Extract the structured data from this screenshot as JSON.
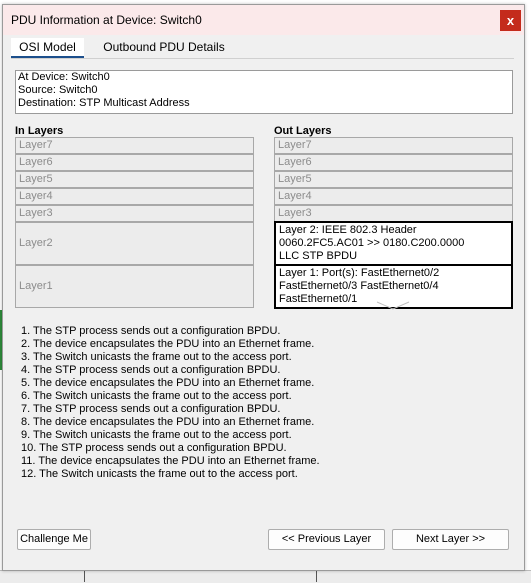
{
  "window": {
    "title": "PDU Information at Device: Switch0",
    "close_label": "x"
  },
  "tabs": [
    {
      "label": "OSI Model",
      "active": true
    },
    {
      "label": "Outbound PDU Details",
      "active": false
    }
  ],
  "info": {
    "device_line": "At Device: Switch0",
    "source_line": "Source: Switch0",
    "destination_line": "Destination: STP Multicast Address"
  },
  "in_layers": {
    "header": "In Layers",
    "items": [
      "Layer7",
      "Layer6",
      "Layer5",
      "Layer4",
      "Layer3",
      "Layer2",
      "Layer1"
    ]
  },
  "out_layers": {
    "header": "Out Layers",
    "items": [
      "Layer7",
      "Layer6",
      "Layer5",
      "Layer4",
      "Layer3",
      "Layer 2: IEEE 802.3 Header 0060.2FC5.AC01 >> 0180.C200.0000 LLC STP BPDU",
      "Layer 1: Port(s): FastEthernet0/2 FastEthernet0/3 FastEthernet0/4 FastEthernet0/1"
    ],
    "layer2_lines": [
      "Layer 2: IEEE 802.3 Header",
      "0060.2FC5.AC01 >> 0180.C200.0000",
      "LLC STP BPDU"
    ],
    "layer1_lines": [
      "Layer 1: Port(s): FastEthernet0/2",
      "FastEthernet0/3 FastEthernet0/4",
      "FastEthernet0/1"
    ]
  },
  "steps": [
    "1. The STP process sends out a configuration BPDU.",
    "2. The device encapsulates the PDU into an Ethernet frame.",
    "3. The Switch unicasts the frame out to the access port.",
    "4. The STP process sends out a configuration BPDU.",
    "5. The device encapsulates the PDU into an Ethernet frame.",
    "6. The Switch unicasts the frame out to the access port.",
    "7. The STP process sends out a configuration BPDU.",
    "8. The device encapsulates the PDU into an Ethernet frame.",
    "9. The Switch unicasts the frame out to the access port.",
    "10. The STP process sends out a configuration BPDU.",
    "11. The device encapsulates the PDU into an Ethernet frame.",
    "12. The Switch unicasts the frame out to the access port."
  ],
  "buttons": {
    "challenge": "Challenge Me",
    "previous": "<< Previous Layer",
    "next": "Next Layer >>"
  },
  "colors": {
    "title_bg": "#fbe9ea",
    "close_bg": "#c42b1c",
    "tab_underline": "#1c4f8c",
    "bg_strip": "#2e8b3a"
  },
  "icons": {
    "close": "close-icon",
    "collapse": "chevron-down-icon"
  }
}
